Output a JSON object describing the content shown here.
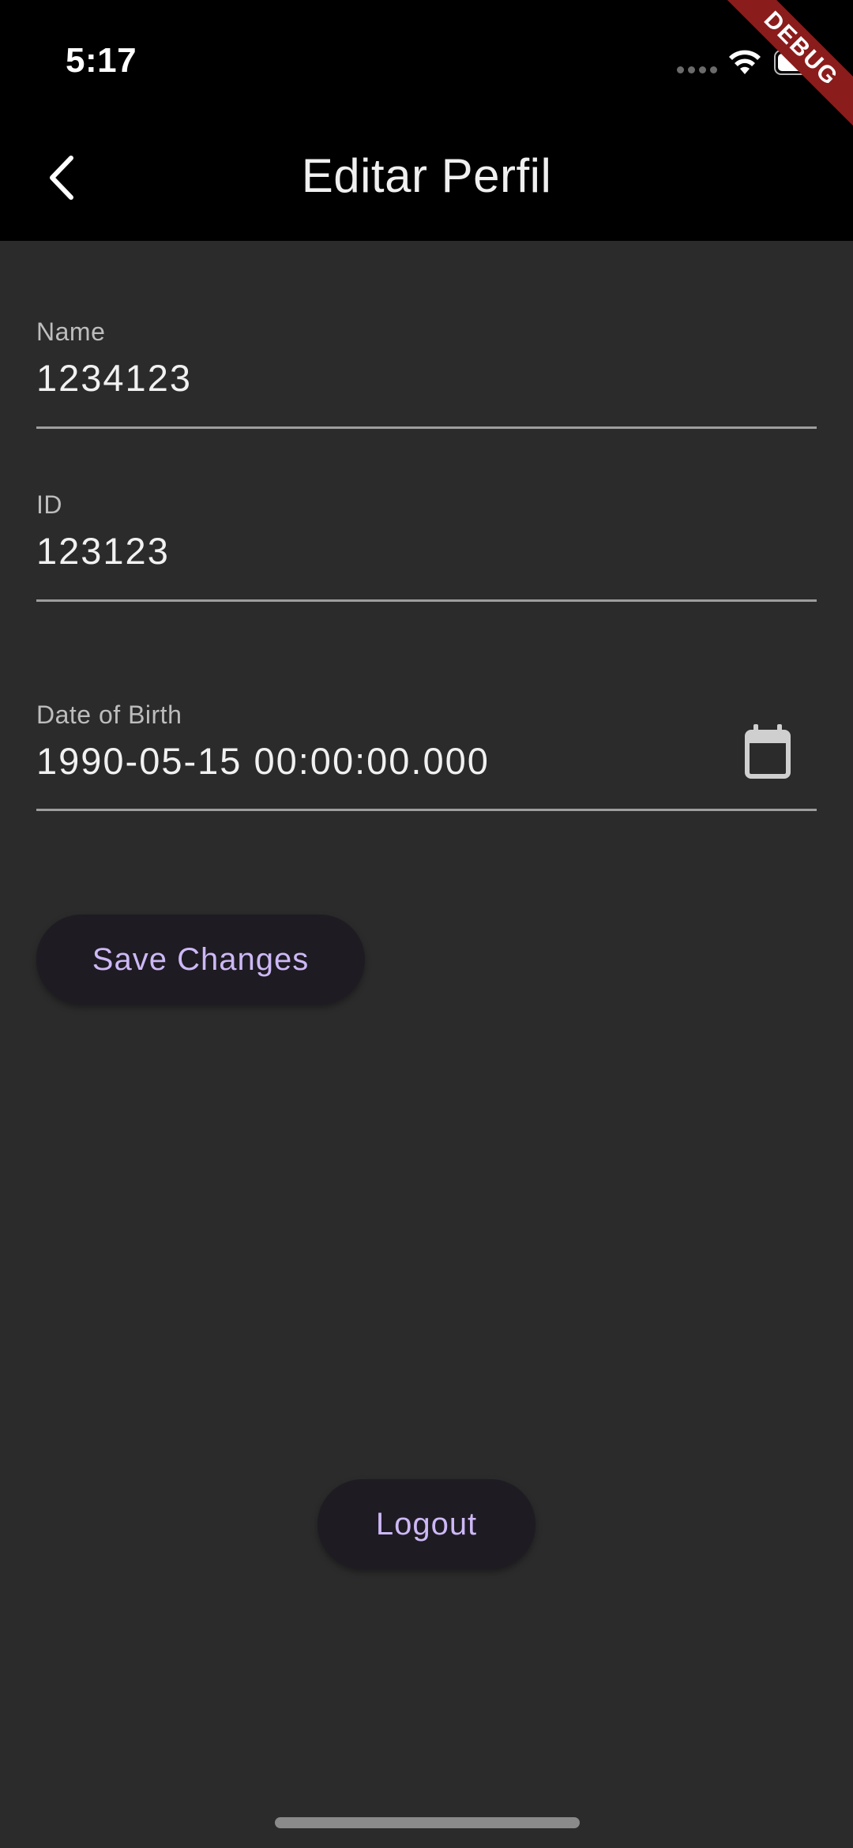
{
  "status_bar": {
    "time": "5:17"
  },
  "debug_banner": "DEBUG",
  "app_bar": {
    "title": "Editar Perfil",
    "back_icon": "chevron-left-icon"
  },
  "form": {
    "name": {
      "label": "Name",
      "value": "1234123"
    },
    "id": {
      "label": "ID",
      "value": "123123"
    },
    "dob": {
      "label": "Date of Birth",
      "value": "1990-05-15 00:00:00.000",
      "icon": "calendar-icon"
    }
  },
  "actions": {
    "save_label": "Save Changes",
    "logout_label": "Logout"
  },
  "colors": {
    "background": "#2b2b2b",
    "app_bar": "#000000",
    "button_bg": "#1e1b22",
    "button_text": "#cdb8f6",
    "debug_ribbon": "#8b1c1c"
  }
}
